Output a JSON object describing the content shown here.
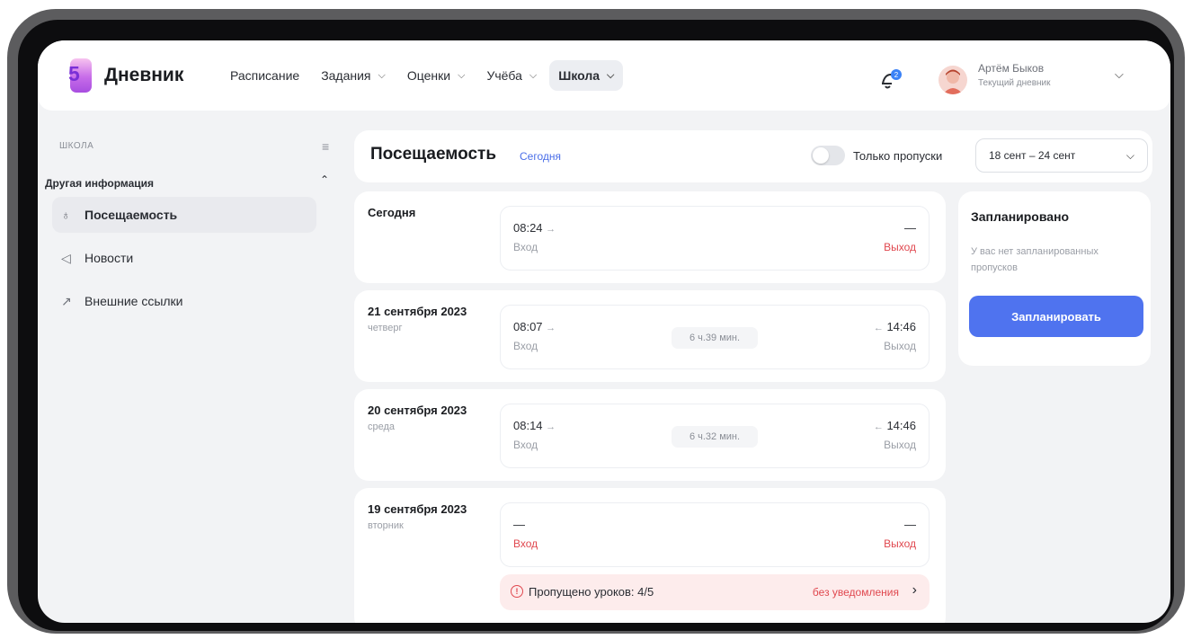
{
  "header": {
    "logo_number": "5",
    "app_name": "Дневник",
    "nav": [
      {
        "label": "Расписание",
        "chevron": false
      },
      {
        "label": "Задания",
        "chevron": true
      },
      {
        "label": "Оценки",
        "chevron": true
      },
      {
        "label": "Учёба",
        "chevron": true
      },
      {
        "label": "Школа",
        "chevron": true,
        "active": true
      }
    ],
    "notification_count": "2",
    "user_name": "Артём Быков",
    "user_subtitle": "Текущий дневник"
  },
  "sidebar": {
    "section_title": "ШКОЛА",
    "group_title": "Другая информация",
    "items": [
      {
        "label": "Посещаемость",
        "icon": "person-walk-icon",
        "active": true
      },
      {
        "label": "Новости",
        "icon": "megaphone-icon"
      },
      {
        "label": "Внешние ссылки",
        "icon": "external-link-icon"
      }
    ]
  },
  "attendance": {
    "title": "Посещаемость",
    "today_link": "Сегодня",
    "only_absences_label": "Только пропуски",
    "date_range": "18 сент – 24 сент",
    "days": [
      {
        "date": "Сегодня",
        "weekday": "",
        "in_time": "08:24",
        "in_label": "Вход",
        "out_time": "—",
        "out_label": "Выход",
        "duration": ""
      },
      {
        "date": "21 сентября 2023",
        "weekday": "четверг",
        "in_time": "08:07",
        "in_label": "Вход",
        "out_time": "14:46",
        "out_label": "Выход",
        "duration": "6 ч.39 мин."
      },
      {
        "date": "20 сентября 2023",
        "weekday": "среда",
        "in_time": "08:14",
        "in_label": "Вход",
        "out_time": "14:46",
        "out_label": "Выход",
        "duration": "6 ч.32 мин."
      },
      {
        "date": "19 сентября 2023",
        "weekday": "вторник",
        "in_time": "—",
        "in_label": "Вход",
        "out_time": "—",
        "out_label": "Выход",
        "duration": "",
        "missed_text": "Пропущено уроков: 4/5",
        "missed_note": "без уведомления"
      }
    ]
  },
  "planned": {
    "title": "Запланировано",
    "text": "У вас нет запланированных пропусков",
    "button": "Запланировать"
  },
  "colors": {
    "accent": "#4f73ef",
    "danger": "#e0484f",
    "link": "#4a6ee8"
  }
}
